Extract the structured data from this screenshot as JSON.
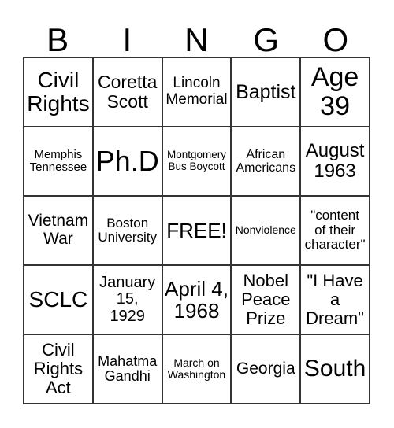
{
  "header": [
    "B",
    "I",
    "N",
    "G",
    "O"
  ],
  "cells": [
    "Civil\nRights",
    "Coretta\nScott",
    "Lincoln\nMemorial",
    "Baptist",
    "Age\n39",
    "Memphis\nTennessee",
    "Ph.D",
    "Montgomery\nBus Boycott",
    "African\nAmericans",
    "August\n1963",
    "Vietnam\nWar",
    "Boston\nUniversity",
    "FREE!",
    "Nonviolence",
    "\"content\nof their\ncharacter\"",
    "SCLC",
    "January\n15,\n1929",
    "April 4,\n1968",
    "Nobel\nPeace\nPrize",
    "\"I Have\na\nDream\"",
    "Civil\nRights\nAct",
    "Mahatma\nGandhi",
    "March on\nWashington",
    "Georgia",
    "South"
  ]
}
